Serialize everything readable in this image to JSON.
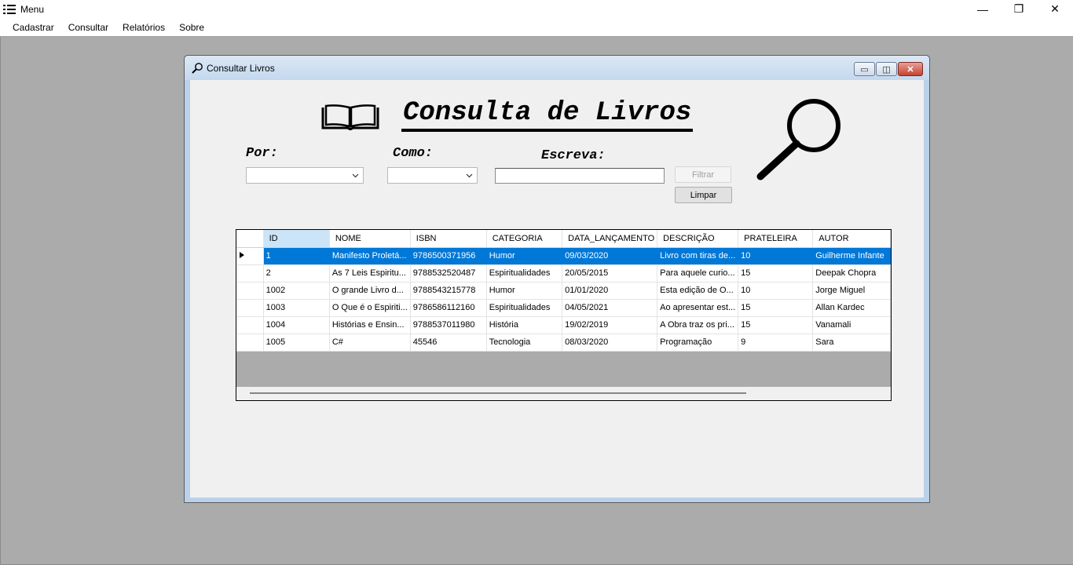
{
  "app": {
    "title": "Menu",
    "controls": [
      "—",
      "❐",
      "✕"
    ]
  },
  "menu": [
    "Cadastrar",
    "Consultar",
    "Relatórios",
    "Sobre"
  ],
  "child_window": {
    "title": "Consultar Livros",
    "controls": [
      "▭",
      "◫",
      "✕"
    ]
  },
  "form": {
    "heading": "Consulta de Livros",
    "label_por": "Por:",
    "label_como": "Como:",
    "label_escreva": "Escreva:",
    "por_value": "",
    "como_value": "",
    "escreva_value": "",
    "filter_button": "Filtrar",
    "clear_button": "Limpar"
  },
  "grid": {
    "columns": [
      "ID",
      "NOME",
      "ISBN",
      "CATEGORIA",
      "DATA_LANÇAMENTO",
      "DESCRIÇÃO",
      "PRATELEIRA",
      "AUTOR"
    ],
    "selected_row": 0,
    "rows": [
      [
        "1",
        "Manifesto Proletá...",
        "9786500371956",
        "Humor",
        "09/03/2020",
        "Livro com tiras de...",
        "10",
        "Guilherme Infante"
      ],
      [
        "2",
        "As 7 Leis Espiritu...",
        "9788532520487",
        "Espiritualidades",
        "20/05/2015",
        "Para aquele curio...",
        "15",
        "Deepak Chopra"
      ],
      [
        "1002",
        "O grande Livro d...",
        "9788543215778",
        "Humor",
        "01/01/2020",
        "Esta edição de O...",
        "10",
        "Jorge Miguel"
      ],
      [
        "1003",
        "O Que é o Espiriti...",
        "9786586112160",
        "Espiritualidades",
        "04/05/2021",
        "Ao apresentar est...",
        "15",
        "Allan Kardec"
      ],
      [
        "1004",
        "Histórias e Ensin...",
        "9788537011980",
        "História",
        "19/02/2019",
        "A Obra traz os pri...",
        "15",
        "Vanamali"
      ],
      [
        "1005",
        "C#",
        "45546",
        "Tecnologia",
        "08/03/2020",
        "Programação",
        "9",
        "Sara"
      ]
    ]
  },
  "colors": {
    "selection": "#0078d7",
    "mdi_background": "#ababab",
    "client_background": "#f0f0f0"
  }
}
